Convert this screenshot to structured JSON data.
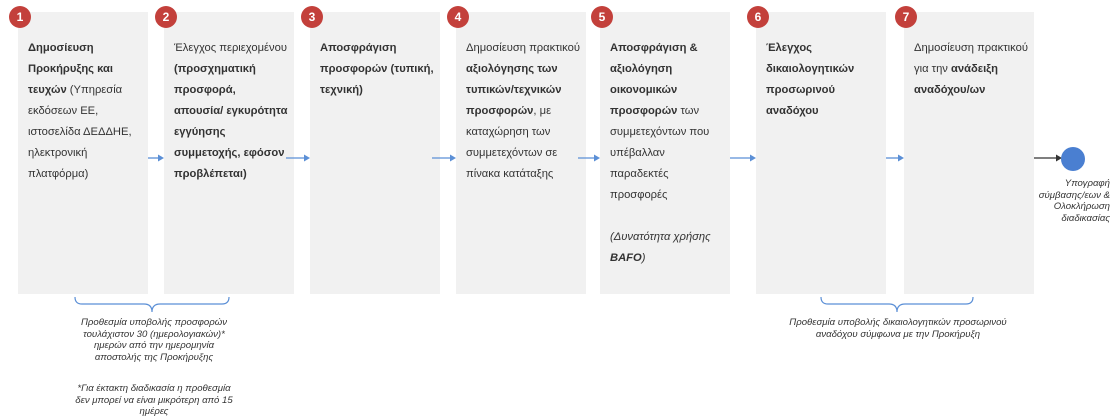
{
  "steps": [
    {
      "number": "1",
      "segments": [
        {
          "text": "Δημοσίευση Προκήρυξης και τευχών",
          "bold": true
        },
        {
          "text": " (Υπηρεσία εκδόσεων ΕΕ, ιστοσελίδα ΔΕΔΔΗΕ, ηλεκτρονική πλατφόρμα)",
          "bold": false
        }
      ]
    },
    {
      "number": "2",
      "segments": [
        {
          "text": "Έλεγχος περιεχομένου ",
          "bold": false
        },
        {
          "text": "(προσχηματική προσφορά, απουσία/ εγκυρότητα εγγύησης συμμετοχής, εφόσον προβλέπεται)",
          "bold": true
        }
      ]
    },
    {
      "number": "3",
      "segments": [
        {
          "text": "Αποσφράγιση προσφορών",
          "bold": true
        },
        {
          "text": " (τυπική, τεχνική)",
          "bold": true
        }
      ]
    },
    {
      "number": "4",
      "segments": [
        {
          "text": "Δημοσίευση πρακτικού ",
          "bold": false
        },
        {
          "text": "αξιολόγησης των τυπικών/τεχνικών προσφορών",
          "bold": true
        },
        {
          "text": ", με καταχώρηση των συμμετεχόντων σε πίνακα κατάταξης",
          "bold": false
        }
      ]
    },
    {
      "number": "5",
      "segments": [
        {
          "text": "Αποσφράγιση & αξιολόγηση οικονομικών προσφορών",
          "bold": true
        },
        {
          "text": " των συμμετεχόντων που υπέβαλλαν παραδεκτές προσφορές",
          "bold": false
        },
        {
          "text": "\n\n",
          "bold": false
        },
        {
          "text": "(Δυνατότητα χρήσης ",
          "bold": false,
          "italic": true
        },
        {
          "text": "BAFO",
          "bold": true,
          "italic": true
        },
        {
          "text": ")",
          "bold": false,
          "italic": true
        }
      ]
    },
    {
      "number": "6",
      "segments": [
        {
          "text": "Έλεγχος δικαιολογητικών προσωρινού αναδόχου",
          "bold": true
        }
      ]
    },
    {
      "number": "7",
      "segments": [
        {
          "text": "Δημοσίευση πρακτικού για την ",
          "bold": false
        },
        {
          "text": "ανάδειξη αναδόχου/ων",
          "bold": true
        }
      ]
    }
  ],
  "end_label": "Υπογραφή σύμβασης/εων & Ολοκλήρωση διαδικασίας",
  "note_left": "Προθεσμία υποβολής προσφορών τουλάχιστον 30 (ημερολογιακών)* ημερών από την ημερομηνία αποστολής της Προκήρυξης",
  "note_left_footnote": "*Για έκτακτη διαδικασία η προθεσμία δεν μπορεί να είναι μικρότερη από 15 ημέρες",
  "note_right": "Προθεσμία υποβολής δικαιολογητικών προσωρινού αναδόχου σύμφωνα με την Προκήρυξη",
  "colors": {
    "box_fill": "#f1f1f1",
    "badge": "#c3403b",
    "arrow": "#5b8fd6",
    "end_dot": "#4a7fd1"
  }
}
